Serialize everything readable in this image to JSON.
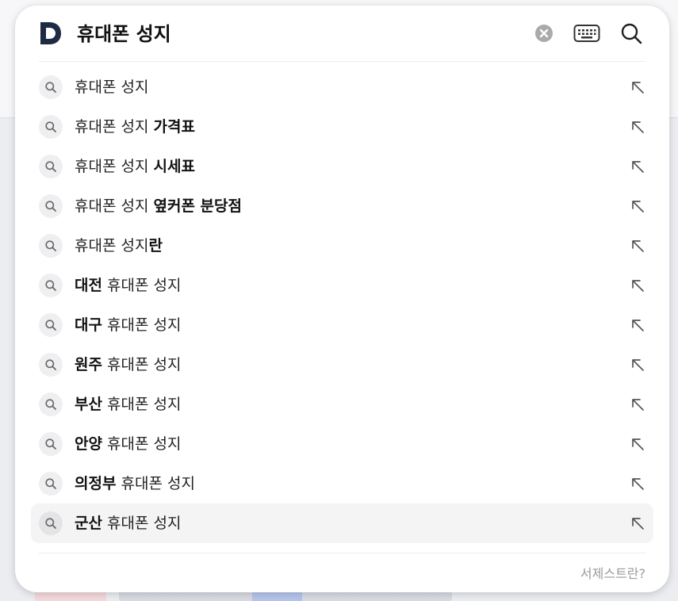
{
  "search": {
    "logo_letter": "D",
    "query": "휴대폰 성지",
    "icons": {
      "logo": "daum-logo-icon",
      "clear": "clear-circle-icon",
      "keyboard": "keyboard-icon",
      "search": "search-icon",
      "suggestion": "search-icon",
      "insert": "arrow-up-left-icon"
    },
    "suggestions": [
      {
        "prefix": "",
        "base": "휴대폰 성지",
        "suffix": ""
      },
      {
        "prefix": "",
        "base": "휴대폰 성지 ",
        "suffix": "가격표"
      },
      {
        "prefix": "",
        "base": "휴대폰 성지 ",
        "suffix": "시세표"
      },
      {
        "prefix": "",
        "base": "휴대폰 성지 ",
        "suffix": "옆커폰 분당점"
      },
      {
        "prefix": "",
        "base": "휴대폰 성지",
        "suffix": "란"
      },
      {
        "prefix": "대전",
        "base": " 휴대폰 성지",
        "suffix": ""
      },
      {
        "prefix": "대구",
        "base": " 휴대폰 성지",
        "suffix": ""
      },
      {
        "prefix": "원주",
        "base": " 휴대폰 성지",
        "suffix": ""
      },
      {
        "prefix": "부산",
        "base": " 휴대폰 성지",
        "suffix": ""
      },
      {
        "prefix": "안양",
        "base": " 휴대폰 성지",
        "suffix": ""
      },
      {
        "prefix": "의정부",
        "base": " 휴대폰 성지",
        "suffix": ""
      },
      {
        "prefix": "군산",
        "base": " 휴대폰 성지",
        "suffix": ""
      }
    ],
    "active_index": 11,
    "help_link": "서제스트란?"
  },
  "colors": {
    "logo": "#1f2a44",
    "icon_gray": "#999999"
  }
}
